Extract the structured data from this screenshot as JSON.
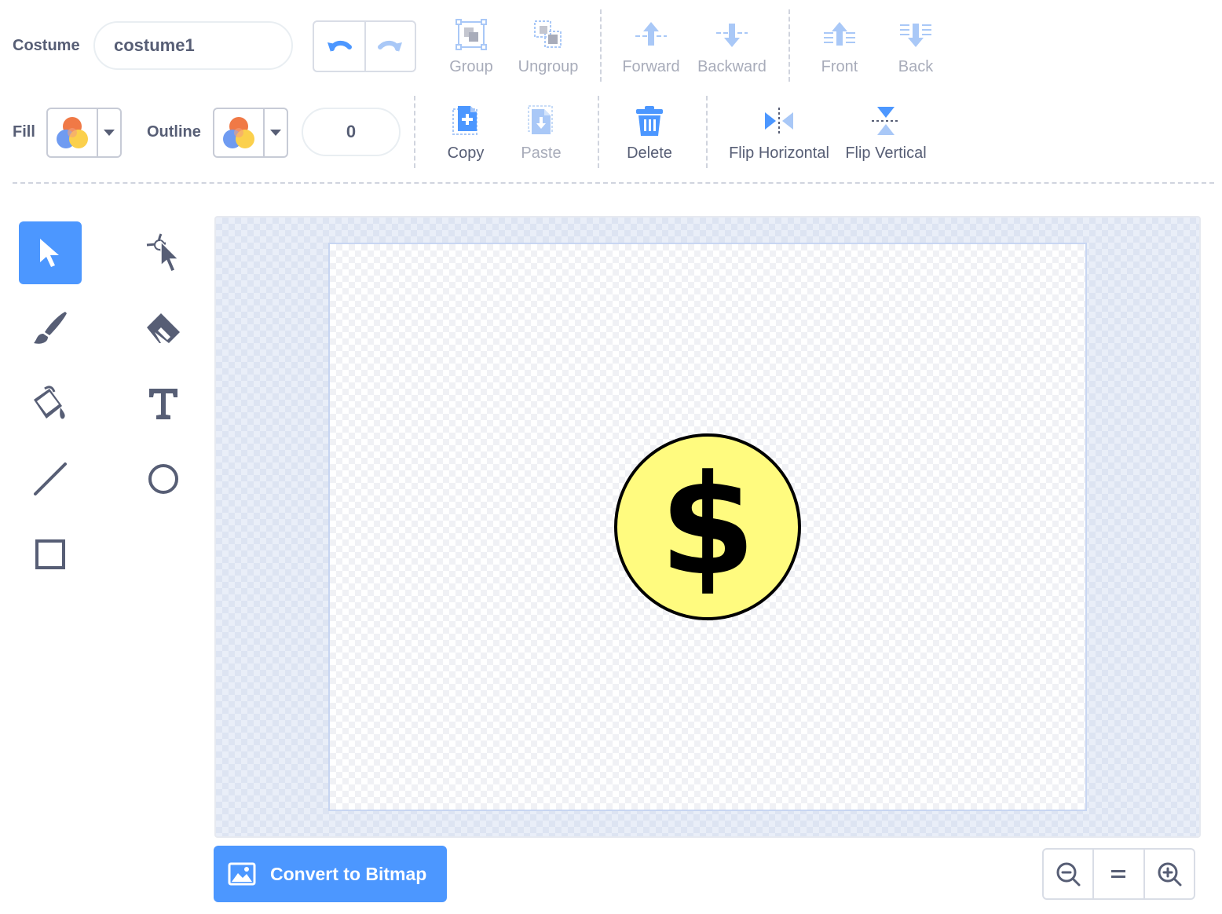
{
  "costume": {
    "label": "Costume",
    "name_value": "costume1"
  },
  "toolbar": {
    "group": "Group",
    "ungroup": "Ungroup",
    "forward": "Forward",
    "backward": "Backward",
    "front": "Front",
    "back": "Back",
    "copy": "Copy",
    "paste": "Paste",
    "delete": "Delete",
    "flip_horizontal": "Flip Horizontal",
    "flip_vertical": "Flip Vertical"
  },
  "fill": {
    "label": "Fill"
  },
  "outline": {
    "label": "Outline",
    "width_value": "0"
  },
  "tools": [
    "select-tool",
    "reshape-tool",
    "brush-tool",
    "eraser-tool",
    "fill-tool",
    "text-tool",
    "line-tool",
    "circle-tool",
    "rectangle-tool"
  ],
  "canvas": {
    "glyph": "$",
    "coin_fill": "#fffb7f",
    "coin_stroke": "#000000"
  },
  "convert_button": {
    "label": "Convert to Bitmap"
  },
  "colors": {
    "accent": "#4c97ff",
    "text": "#575e75",
    "disabled_text": "#a8acba"
  }
}
